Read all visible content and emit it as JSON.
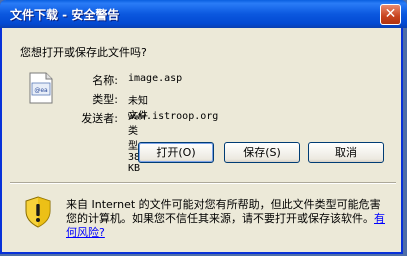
{
  "window": {
    "title": "文件下载 - 安全警告",
    "close_glyph": "✕"
  },
  "dialog": {
    "question": "您想打开或保存此文件吗?",
    "file_icon_text": "@ea",
    "name_label": "名称:",
    "name_value": "image.asp",
    "type_label": "类型:",
    "type_value": "未知文件类型, 38.5 KB",
    "from_label": "发送者:",
    "from_value": "www.istroop.org"
  },
  "buttons": {
    "open": "打开(O)",
    "save": "保存(S)",
    "cancel": "取消"
  },
  "warning": {
    "text": "来自 Internet 的文件可能对您有所帮助，但此文件类型可能危害您的计算机。如果您不信任其来源，请不要打开或保存该软件。",
    "link": "有何风险?"
  },
  "colors": {
    "titlebar": "#0b58df",
    "dialog_bg": "#ece9d8",
    "link": "#0000ff"
  }
}
